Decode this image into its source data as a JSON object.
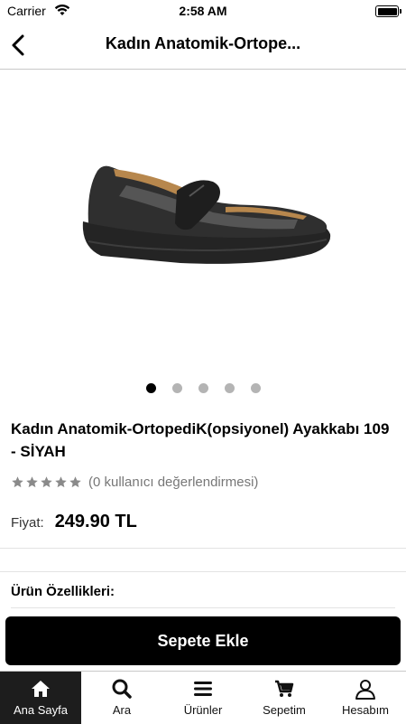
{
  "status_bar": {
    "carrier": "Carrier",
    "time": "2:58 AM"
  },
  "nav": {
    "title": "Kadın Anatomik-Ortope..."
  },
  "product": {
    "name": "Kadın Anatomik-OrtopediK(opsiyonel) Ayakkabı 109 - SİYAH",
    "rating_stars": 5,
    "rating_text": "(0 kullanıcı değerlendirmesi)",
    "price_label": "Fiyat:",
    "price": "249.90 TL",
    "features_title": "Ürün Özellikleri:"
  },
  "carousel": {
    "count": 5,
    "active_index": 0
  },
  "actions": {
    "add_to_cart": "Sepete Ekle"
  },
  "tabbar": {
    "items": [
      {
        "label": "Ana Sayfa",
        "icon": "home-icon",
        "active": true
      },
      {
        "label": "Ara",
        "icon": "search-icon",
        "active": false
      },
      {
        "label": "Ürünler",
        "icon": "menu-icon",
        "active": false
      },
      {
        "label": "Sepetim",
        "icon": "cart-icon",
        "active": false
      },
      {
        "label": "Hesabım",
        "icon": "user-icon",
        "active": false
      }
    ]
  },
  "colors": {
    "accent": "#000000",
    "star": "#8a8a8a",
    "tab_active_bg": "#1d1d1d"
  }
}
